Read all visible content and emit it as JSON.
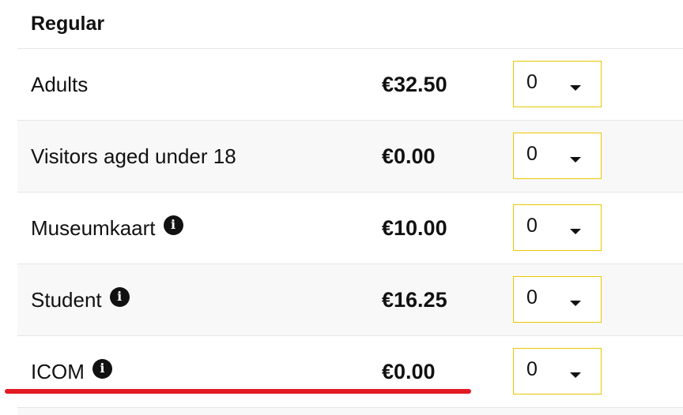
{
  "section": {
    "title": "Regular"
  },
  "tickets": [
    {
      "label": "Adults",
      "price": "€32.50",
      "quantity": "0",
      "has_info": false
    },
    {
      "label": "Visitors aged under 18",
      "price": "€0.00",
      "quantity": "0",
      "has_info": false
    },
    {
      "label": "Museumkaart",
      "price": "€10.00",
      "quantity": "0",
      "has_info": true
    },
    {
      "label": "Student",
      "price": "€16.25",
      "quantity": "0",
      "has_info": true
    },
    {
      "label": "ICOM",
      "price": "€0.00",
      "quantity": "0",
      "has_info": true
    }
  ],
  "icons": {
    "info": "info-icon",
    "dropdown": "caret-down-icon"
  },
  "info_glyph": "i",
  "colors": {
    "select_border": "#e8c700",
    "annotation": "#e31b23",
    "row_alt_background": "#f8f8f8",
    "text": "#111111"
  }
}
